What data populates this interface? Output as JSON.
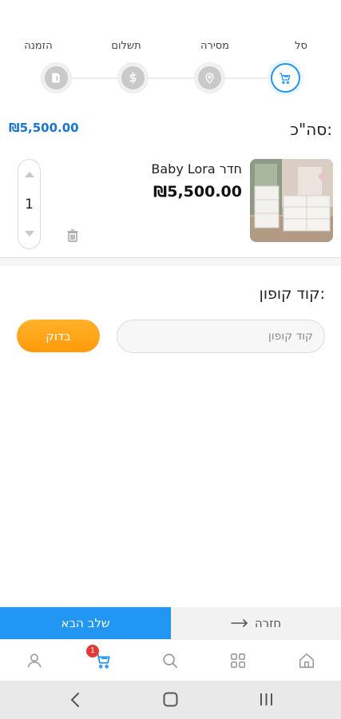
{
  "stepper": {
    "steps": [
      {
        "label": "סל",
        "icon": "cart-icon",
        "active": true
      },
      {
        "label": "מסירה",
        "icon": "location-pin-icon",
        "active": false
      },
      {
        "label": "תשלום",
        "icon": "dollar-icon",
        "active": false
      },
      {
        "label": "הזמנה",
        "icon": "document-icon",
        "active": false
      }
    ]
  },
  "summary": {
    "total_label": "סה\"כ:",
    "total_value": "₪5,500.00"
  },
  "cart_item": {
    "name": "חדר Baby Lora",
    "price": "₪5,500.00",
    "quantity": "1",
    "image_icon": "product-photo-dresser"
  },
  "coupon": {
    "title": "קוד קופון:",
    "placeholder": "קוד קופון",
    "value": "",
    "check_label": "בדוק"
  },
  "actions": {
    "back_label": "חזרה",
    "next_label": "שלב הבא"
  },
  "tabbar": {
    "items": [
      "home-icon",
      "categories-icon",
      "search-icon",
      "cart-icon",
      "user-icon"
    ],
    "cart_badge": "1",
    "active_color": "#2196f3"
  },
  "colors": {
    "accent": "#2196f3",
    "price": "#1976d2",
    "check_button": "#ff9f10"
  }
}
